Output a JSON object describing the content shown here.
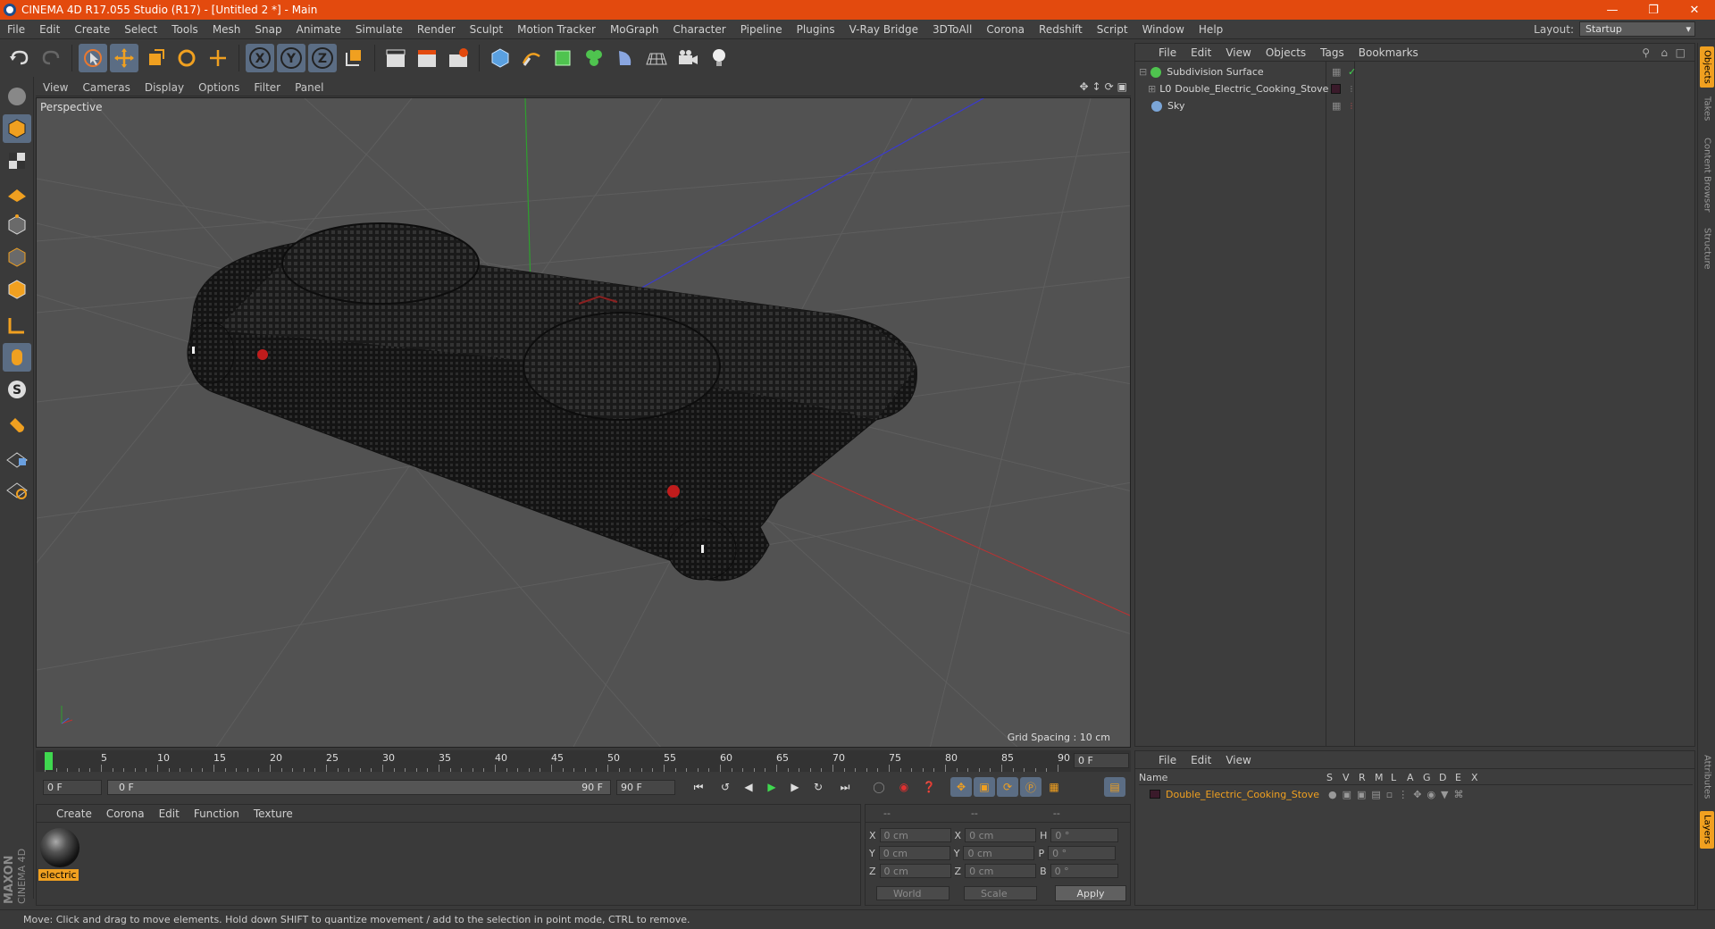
{
  "window": {
    "title": "CINEMA 4D R17.055 Studio (R17) - [Untitled 2 *] - Main"
  },
  "menubar": [
    "File",
    "Edit",
    "Create",
    "Select",
    "Tools",
    "Mesh",
    "Snap",
    "Animate",
    "Simulate",
    "Render",
    "Sculpt",
    "Motion Tracker",
    "MoGraph",
    "Character",
    "Pipeline",
    "Plugins",
    "V-Ray Bridge",
    "3DToAll",
    "Corona",
    "Redshift",
    "Script",
    "Window",
    "Help"
  ],
  "layout": {
    "label": "Layout:",
    "value": "Startup"
  },
  "viewport": {
    "menu": [
      "View",
      "Cameras",
      "Display",
      "Options",
      "Filter",
      "Panel"
    ],
    "label": "Perspective",
    "grid_spacing": "Grid Spacing : 10 cm"
  },
  "timeline": {
    "ticks": [
      "0",
      "5",
      "10",
      "15",
      "20",
      "25",
      "30",
      "35",
      "40",
      "45",
      "50",
      "55",
      "60",
      "65",
      "70",
      "75",
      "80",
      "85",
      "90"
    ],
    "end_frame": "0 F",
    "start_field": "0 F",
    "range_start": "0 F",
    "range_end": "90 F",
    "max_field": "90 F"
  },
  "material_panel": {
    "menu": [
      "Create",
      "Corona",
      "Edit",
      "Function",
      "Texture"
    ],
    "material_name": "electric"
  },
  "coordinates": {
    "header": [
      "--",
      "--",
      "--"
    ],
    "rows": [
      {
        "a": "X",
        "av": "0 cm",
        "b": "X",
        "bv": "0 cm",
        "c": "H",
        "cv": "0 °"
      },
      {
        "a": "Y",
        "av": "0 cm",
        "b": "Y",
        "bv": "0 cm",
        "c": "P",
        "cv": "0 °"
      },
      {
        "a": "Z",
        "av": "0 cm",
        "b": "Z",
        "bv": "0 cm",
        "c": "B",
        "cv": "0 °"
      }
    ],
    "space": "World",
    "mode": "Scale",
    "apply": "Apply"
  },
  "object_manager": {
    "menu": [
      "File",
      "Edit",
      "View",
      "Objects",
      "Tags",
      "Bookmarks"
    ],
    "objects": [
      {
        "name": "Subdivision Surface",
        "icon_color": "#4fc34f"
      },
      {
        "name": "Double_Electric_Cooking_Stove",
        "icon_color": "#cfcfcf"
      },
      {
        "name": "Sky",
        "icon_color": "#7ba6d8"
      }
    ]
  },
  "layer_manager": {
    "menu": [
      "File",
      "Edit",
      "View"
    ],
    "columns": [
      "Name",
      "S",
      "V",
      "R",
      "M",
      "L",
      "A",
      "G",
      "D",
      "E",
      "X"
    ],
    "layer_name": "Double_Electric_Cooking_Stove"
  },
  "right_tabs": [
    "Objects",
    "Takes",
    "Content Browser",
    "Structure",
    "Attributes",
    "Layers"
  ],
  "statusbar": "Move: Click and drag to move elements. Hold down SHIFT to quantize movement / add to the selection in point mode, CTRL to remove.",
  "brand": {
    "line1": "MAXON",
    "line2": "CINEMA 4D"
  },
  "colors": {
    "title_bar": "#e34a0e",
    "accent": "#f0a020",
    "selected_tool": "#5b6d84"
  }
}
